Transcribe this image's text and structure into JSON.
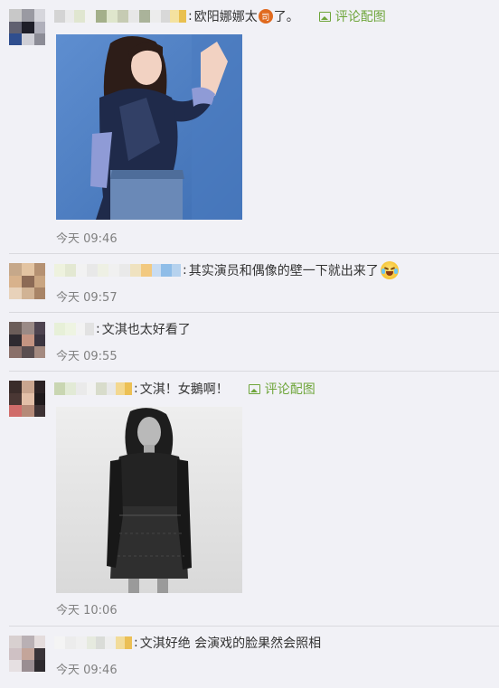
{
  "comments": [
    {
      "text": "欧阳娜娜太",
      "emoji": "司",
      "text_after": "了。",
      "link_label": "评论配图",
      "time": "今天 09:46"
    },
    {
      "text": "其实演员和偶像的壁一下就出来了",
      "time": "今天 09:57"
    },
    {
      "text": "文淇也太好看了",
      "time": "今天 09:55"
    },
    {
      "text": "文淇！女鵝啊！",
      "link_label": "评论配图",
      "time": "今天 10:06"
    },
    {
      "text": "文淇好绝 会演戏的脸果然会照相",
      "time": "今天 09:46"
    }
  ],
  "icons": {
    "picture": "image-icon",
    "emoji_laugh": "laughing-tears-emoji-icon"
  },
  "colors": {
    "background": "#f1f1f6",
    "link": "#6ea53a",
    "time": "#808080"
  }
}
